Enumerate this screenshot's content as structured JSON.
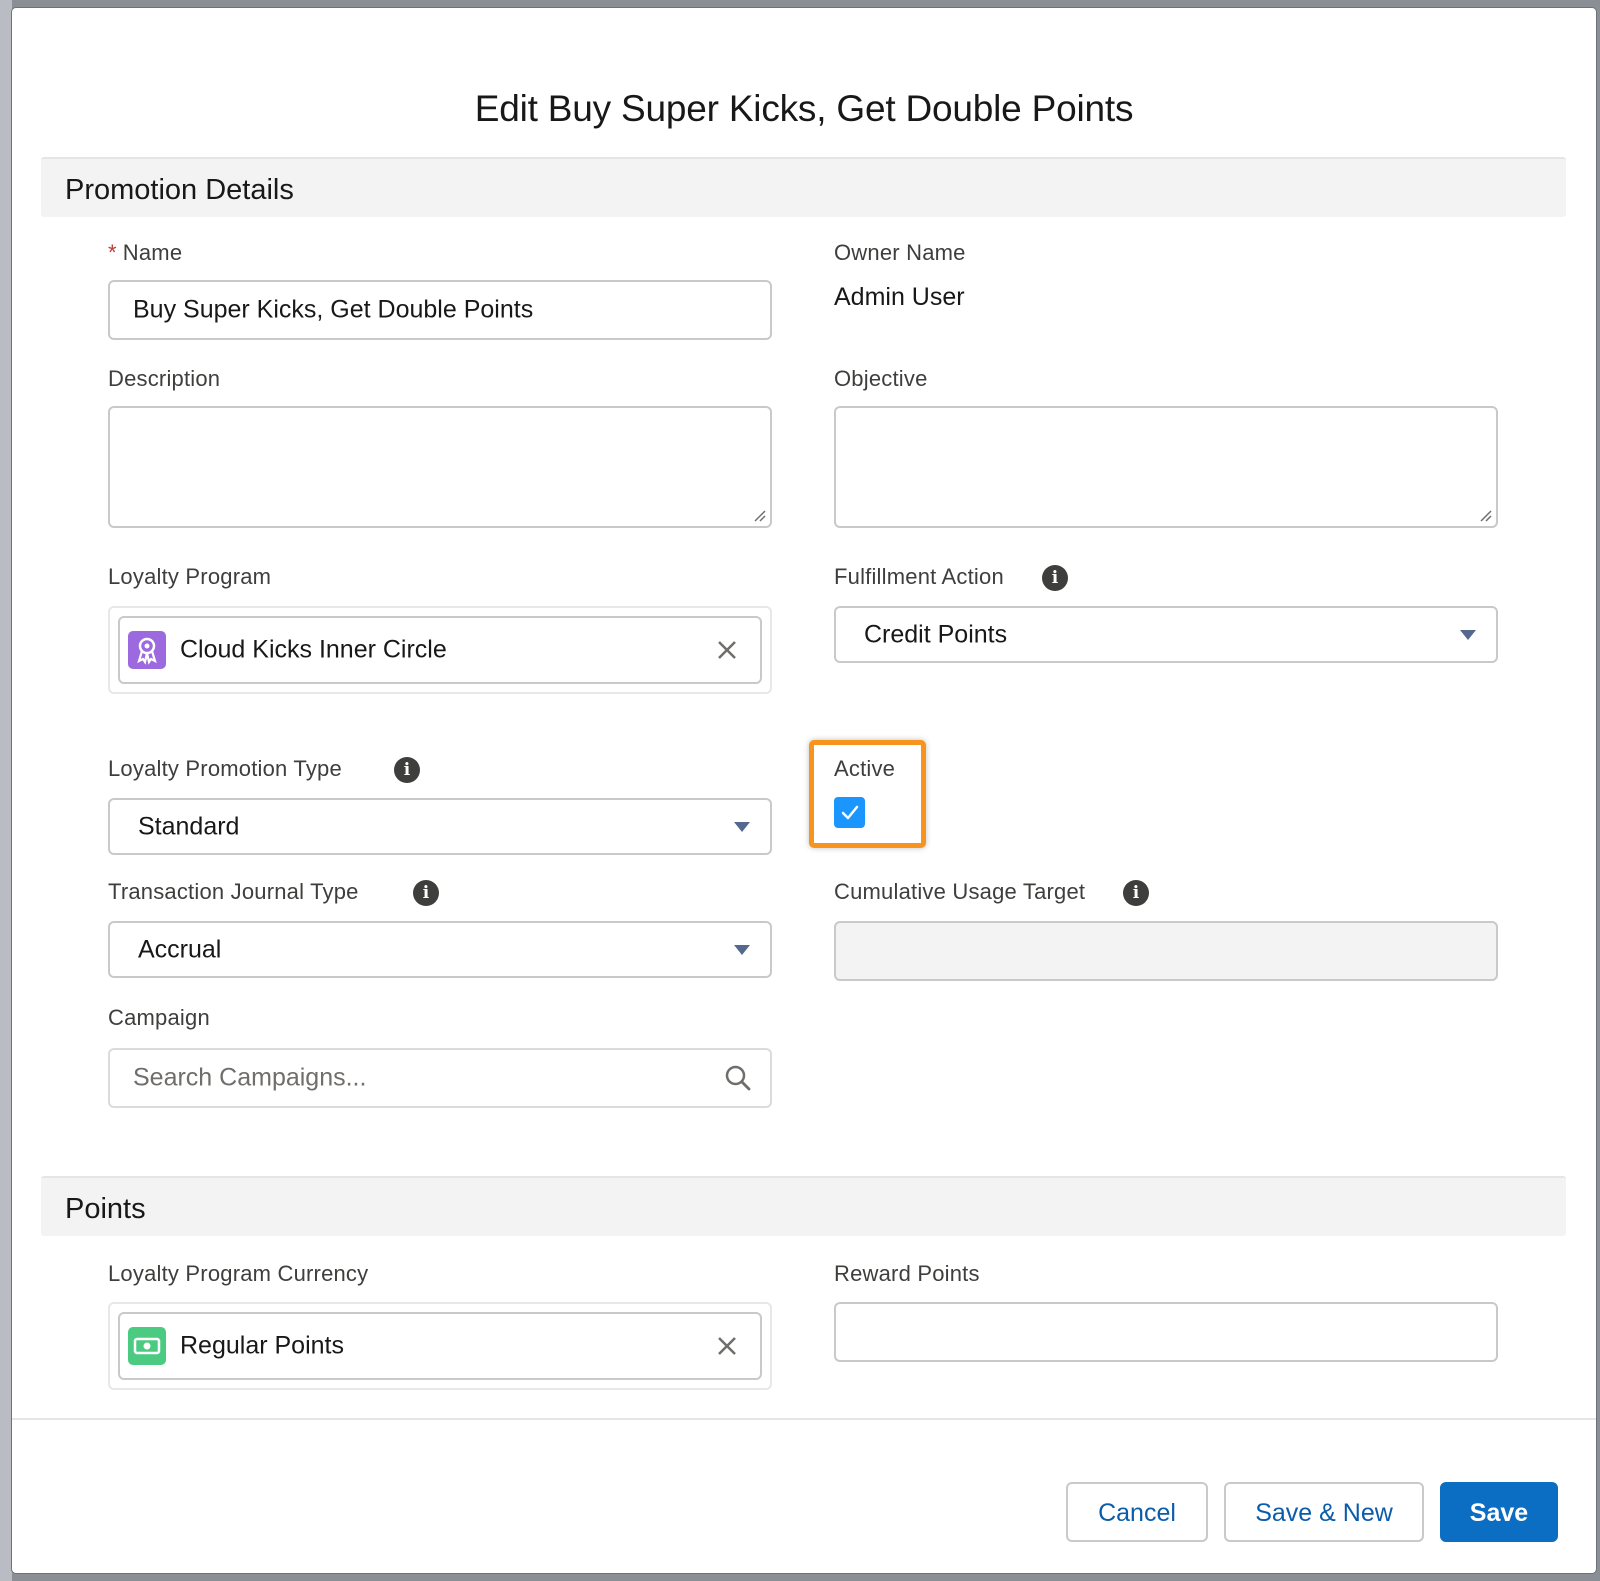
{
  "modal": {
    "title": "Edit Buy Super Kicks, Get Double Points"
  },
  "sections": {
    "promotion_details": "Promotion Details",
    "points": "Points"
  },
  "fields": {
    "name": {
      "label": "Name",
      "required_marker": "*",
      "value": "Buy Super Kicks, Get Double Points"
    },
    "owner_name": {
      "label": "Owner Name",
      "value": "Admin User"
    },
    "description": {
      "label": "Description",
      "value": ""
    },
    "objective": {
      "label": "Objective",
      "value": ""
    },
    "loyalty_program": {
      "label": "Loyalty Program",
      "value": "Cloud Kicks Inner Circle",
      "icon": "award-ribbon-icon"
    },
    "fulfillment_action": {
      "label": "Fulfillment Action",
      "value": "Credit Points"
    },
    "loyalty_promotion_type": {
      "label": "Loyalty Promotion Type",
      "value": "Standard"
    },
    "active": {
      "label": "Active",
      "checked": true
    },
    "transaction_journal_type": {
      "label": "Transaction Journal Type",
      "value": "Accrual"
    },
    "cumulative_usage_target": {
      "label": "Cumulative Usage Target",
      "value": ""
    },
    "campaign": {
      "label": "Campaign",
      "placeholder": "Search Campaigns..."
    },
    "loyalty_program_currency": {
      "label": "Loyalty Program Currency",
      "value": "Regular Points",
      "icon": "cash-icon"
    },
    "reward_points": {
      "label": "Reward Points",
      "value": ""
    }
  },
  "footer": {
    "cancel_label": "Cancel",
    "save_new_label": "Save & New",
    "save_label": "Save"
  },
  "colors": {
    "brand": "#0b6ec2",
    "highlight": "#f7941d",
    "checkbox": "#1b96ff",
    "program_icon": "#9c6ade",
    "currency_icon": "#4bca81"
  }
}
